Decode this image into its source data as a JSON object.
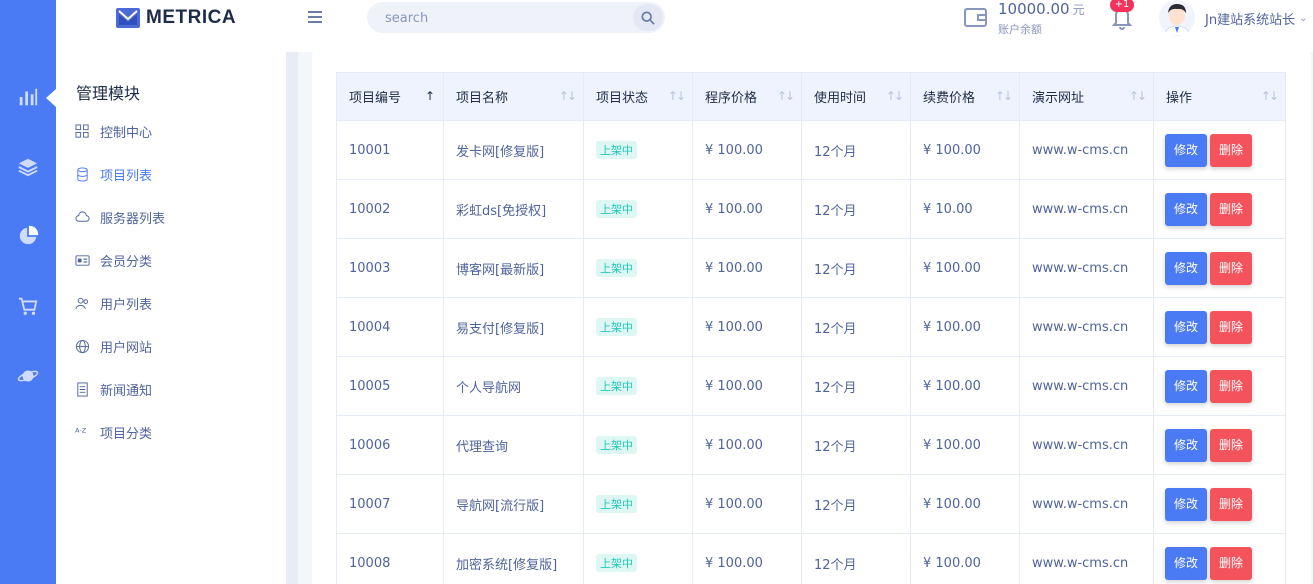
{
  "brand": {
    "name": "METRICA"
  },
  "search": {
    "placeholder": "search"
  },
  "balance": {
    "amount": "10000.00",
    "unit": "元",
    "label": "账户余额"
  },
  "notifications": {
    "badge": "+1"
  },
  "user": {
    "name": "Jn建站系统站长"
  },
  "rail": {
    "items": [
      {
        "icon": "bar-chart-icon"
      },
      {
        "icon": "layers-icon"
      },
      {
        "icon": "pie-chart-icon"
      },
      {
        "icon": "cart-icon"
      },
      {
        "icon": "planet-icon"
      }
    ]
  },
  "menu": {
    "title": "管理模块",
    "items": [
      {
        "label": "控制中心",
        "icon": "grid-icon"
      },
      {
        "label": "项目列表",
        "icon": "database-icon",
        "active": true
      },
      {
        "label": "服务器列表",
        "icon": "cloud-icon"
      },
      {
        "label": "会员分类",
        "icon": "id-card-icon"
      },
      {
        "label": "用户列表",
        "icon": "users-icon"
      },
      {
        "label": "用户网站",
        "icon": "globe-icon"
      },
      {
        "label": "新闻通知",
        "icon": "document-icon"
      },
      {
        "label": "项目分类",
        "icon": "az-icon"
      }
    ]
  },
  "table": {
    "headers": [
      "项目编号",
      "项目名称",
      "项目状态",
      "程序价格",
      "使用时间",
      "续费价格",
      "演示网址",
      "操作"
    ],
    "edit_label": "修改",
    "delete_label": "删除",
    "rows": [
      {
        "id": "10001",
        "name": "发卡网[修复版]",
        "status": "上架中",
        "price": "¥ 100.00",
        "duration": "12个月",
        "renew": "¥ 100.00",
        "url": "www.w-cms.cn"
      },
      {
        "id": "10002",
        "name": "彩虹ds[免授权]",
        "status": "上架中",
        "price": "¥ 100.00",
        "duration": "12个月",
        "renew": "¥ 10.00",
        "url": "www.w-cms.cn"
      },
      {
        "id": "10003",
        "name": "博客网[最新版]",
        "status": "上架中",
        "price": "¥ 100.00",
        "duration": "12个月",
        "renew": "¥ 100.00",
        "url": "www.w-cms.cn"
      },
      {
        "id": "10004",
        "name": "易支付[修复版]",
        "status": "上架中",
        "price": "¥ 100.00",
        "duration": "12个月",
        "renew": "¥ 100.00",
        "url": "www.w-cms.cn"
      },
      {
        "id": "10005",
        "name": "个人导航网",
        "status": "上架中",
        "price": "¥ 100.00",
        "duration": "12个月",
        "renew": "¥ 100.00",
        "url": "www.w-cms.cn"
      },
      {
        "id": "10006",
        "name": "代理查询",
        "status": "上架中",
        "price": "¥ 100.00",
        "duration": "12个月",
        "renew": "¥ 100.00",
        "url": "www.w-cms.cn"
      },
      {
        "id": "10007",
        "name": "导航网[流行版]",
        "status": "上架中",
        "price": "¥ 100.00",
        "duration": "12个月",
        "renew": "¥ 100.00",
        "url": "www.w-cms.cn"
      },
      {
        "id": "10008",
        "name": "加密系统[修复版]",
        "status": "上架中",
        "price": "¥ 100.00",
        "duration": "12个月",
        "renew": "¥ 100.00",
        "url": "www.w-cms.cn"
      }
    ]
  },
  "colors": {
    "primary": "#4b7bf4",
    "danger": "#f5535c",
    "success": "#1ecab8",
    "text": "#50649c",
    "heading": "#1d2c48"
  }
}
